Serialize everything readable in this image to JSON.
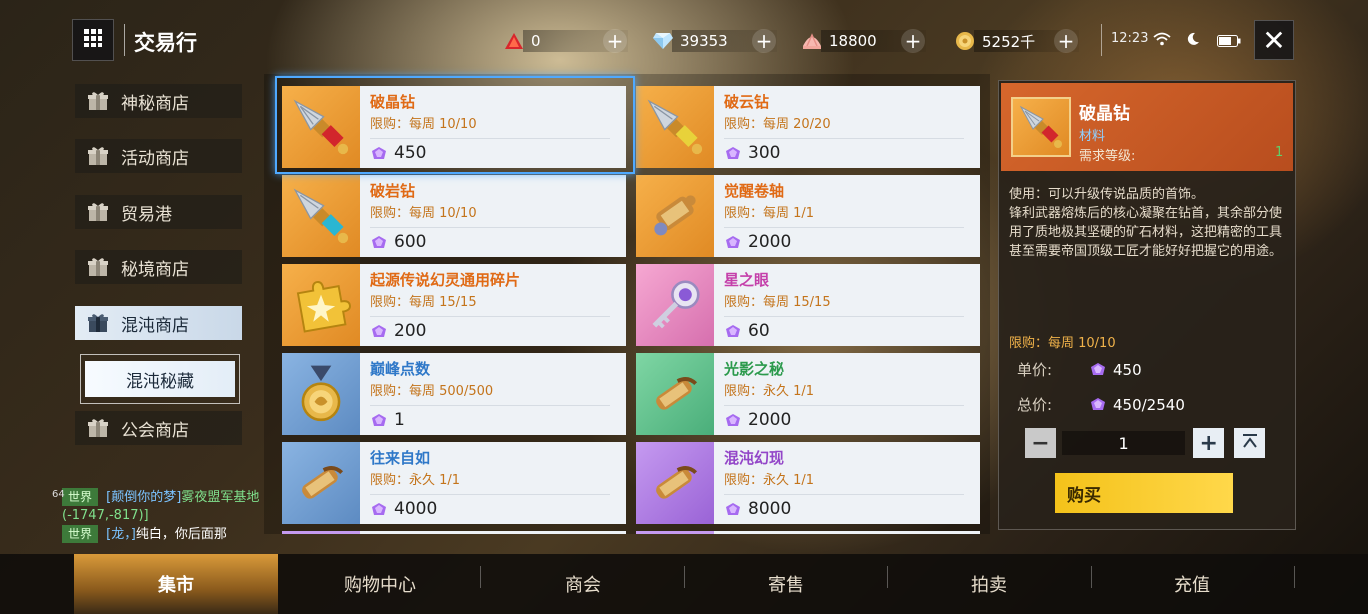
{
  "header": {
    "title": "交易行",
    "currencies": [
      {
        "icon": "red-crystal-icon",
        "value": "0"
      },
      {
        "icon": "diamond-icon",
        "value": "39353"
      },
      {
        "icon": "shell-icon",
        "value": "18800"
      },
      {
        "icon": "gold-coin-icon",
        "value": "5252千"
      }
    ],
    "time": "12:23"
  },
  "sidebar": {
    "items": [
      {
        "label": "神秘商店"
      },
      {
        "label": "活动商店"
      },
      {
        "label": "贸易港"
      },
      {
        "label": "秘境商店"
      },
      {
        "label": "混沌商店"
      },
      {
        "label": "混沌秘藏"
      },
      {
        "label": "公会商店"
      }
    ]
  },
  "chat": {
    "level": "64",
    "lines": [
      {
        "tag": "世界",
        "name": "[颠倒你的梦]",
        "text": "雾夜盟军基地(-1747,-817)]"
      },
      {
        "tag": "世界",
        "name": "[龙，]",
        "text": "纯白，你后面那"
      }
    ]
  },
  "items": [
    {
      "name": "破晶钻",
      "limit": "限购：每周 10/10",
      "price": "450",
      "color": "orange",
      "icon": "drill-red-icon"
    },
    {
      "name": "破云钻",
      "limit": "限购：每周 20/20",
      "price": "300",
      "color": "orange",
      "icon": "drill-yellow-icon"
    },
    {
      "name": "破岩钻",
      "limit": "限购：每周 10/10",
      "price": "600",
      "color": "orange",
      "icon": "drill-cyan-icon"
    },
    {
      "name": "觉醒卷轴",
      "limit": "限购：每周 1/1",
      "price": "2000",
      "color": "orange",
      "icon": "awaken-scroll-icon"
    },
    {
      "name": "起源传说幻灵通用碎片",
      "limit": "限购：每周 15/15",
      "price": "200",
      "color": "orange",
      "icon": "puzzle-piece-icon"
    },
    {
      "name": "星之眼",
      "limit": "限购：每周 15/15",
      "price": "60",
      "color": "pink",
      "icon": "star-key-icon"
    },
    {
      "name": "巅峰点数",
      "limit": "限购：每周 500/500",
      "price": "1",
      "color": "blue",
      "icon": "medal-icon"
    },
    {
      "name": "光影之秘",
      "limit": "限购：永久 1/1",
      "price": "2000",
      "color": "green",
      "icon": "scroll-icon"
    },
    {
      "name": "往来自如",
      "limit": "限购：永久 1/1",
      "price": "4000",
      "color": "blue",
      "icon": "scroll-icon"
    },
    {
      "name": "混沌幻现",
      "limit": "限购：永久 1/1",
      "price": "8000",
      "color": "purple",
      "icon": "scroll-icon"
    }
  ],
  "detail": {
    "name": "破晶钻",
    "type": "材料",
    "req_label": "需求等级:",
    "req_value": "1",
    "description": "使用：可以升级传说品质的首饰。\n锋利武器熔炼后的核心凝聚在钻首，其余部分使用了质地极其坚硬的矿石材料，这把精密的工具甚至需要帝国顶级工匠才能好好把握它的用途。",
    "limit": "限购：每周 10/10",
    "unit_price_label": "单价:",
    "unit_price": "450",
    "total_price_label": "总价:",
    "total_price": "450/2540",
    "quantity": "1",
    "buy_label": "购买"
  },
  "tabs": [
    {
      "label": "集市"
    },
    {
      "label": "购物中心"
    },
    {
      "label": "商会"
    },
    {
      "label": "寄售"
    },
    {
      "label": "拍卖"
    },
    {
      "label": "充值"
    }
  ]
}
